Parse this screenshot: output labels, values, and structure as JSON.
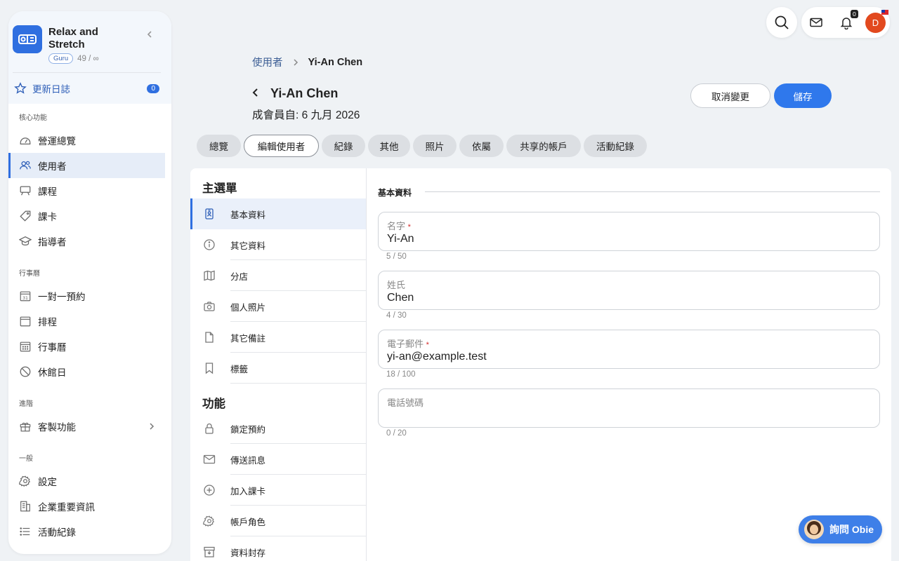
{
  "sidebar": {
    "org_name": "Relax and Stretch",
    "plan_badge": "Guru",
    "usage": "49 / ∞",
    "changelog": {
      "label": "更新日誌",
      "count": "0"
    },
    "sections": [
      {
        "label": "核心功能",
        "items": [
          {
            "label": "營運總覽",
            "icon": "dashboard-icon"
          },
          {
            "label": "使用者",
            "icon": "users-icon",
            "active": true
          },
          {
            "label": "課程",
            "icon": "classroom-icon"
          },
          {
            "label": "課卡",
            "icon": "tag-icon"
          },
          {
            "label": "指導者",
            "icon": "graduation-cap-icon"
          }
        ]
      },
      {
        "label": "行事曆",
        "items": [
          {
            "label": "一對一預約",
            "icon": "calendar-31-icon"
          },
          {
            "label": "排程",
            "icon": "calendar-icon"
          },
          {
            "label": "行事曆",
            "icon": "calendar-grid-icon"
          },
          {
            "label": "休館日",
            "icon": "ban-icon"
          }
        ]
      },
      {
        "label": "進階",
        "items": [
          {
            "label": "客製功能",
            "icon": "gift-icon"
          }
        ]
      },
      {
        "label": "一般",
        "items": [
          {
            "label": "設定",
            "icon": "gear-icon"
          },
          {
            "label": "企業重要資訊",
            "icon": "building-icon"
          },
          {
            "label": "活動紀錄",
            "icon": "list-icon"
          }
        ]
      }
    ]
  },
  "topbar": {
    "bell_count": "0",
    "avatar_initial": "D"
  },
  "breadcrumb": {
    "parent": "使用者",
    "current": "Yi-An Chen"
  },
  "header": {
    "title": "Yi-An Chen",
    "member_since": "成會員自: 6 九月 2026",
    "cancel_label": "取消變更",
    "save_label": "儲存"
  },
  "tabs": [
    "總覽",
    "編輯使用者",
    "紀錄",
    "其他",
    "照片",
    "依屬",
    "共享的帳戶",
    "活動紀錄"
  ],
  "active_tab": "編輯使用者",
  "menu": {
    "main_heading": "主選單",
    "main_items": [
      {
        "label": "基本資料",
        "icon": "id-badge-icon",
        "active": true
      },
      {
        "label": "其它資料",
        "icon": "info-circle-icon"
      },
      {
        "label": "分店",
        "icon": "map-icon"
      },
      {
        "label": "個人照片",
        "icon": "camera-icon"
      },
      {
        "label": "其它備註",
        "icon": "document-icon"
      },
      {
        "label": "標籤",
        "icon": "bookmark-icon"
      }
    ],
    "feature_heading": "功能",
    "feature_items": [
      {
        "label": "鎖定預約",
        "icon": "lock-icon"
      },
      {
        "label": "傳送訊息",
        "icon": "mail-icon"
      },
      {
        "label": "加入課卡",
        "icon": "plus-circle-icon"
      },
      {
        "label": "帳戶角色",
        "icon": "gear-icon"
      },
      {
        "label": "資料封存",
        "icon": "archive-icon"
      }
    ]
  },
  "form": {
    "section_title": "基本資料",
    "fields": [
      {
        "label": "名字",
        "required": true,
        "value": "Yi-An",
        "counter": "5 / 50"
      },
      {
        "label": "姓氏",
        "required": false,
        "value": "Chen",
        "counter": "4 / 30"
      },
      {
        "label": "電子郵件",
        "required": true,
        "value": "yi-an@example.test",
        "counter": "18 / 100"
      },
      {
        "label": "電話號碼",
        "required": false,
        "value": "",
        "counter": "0 / 20"
      }
    ]
  },
  "assistant": {
    "label": "詢問 Obie"
  },
  "colors": {
    "accent": "#2f6fe0",
    "save": "#2f78ec",
    "avatar": "#e2491e",
    "required": "#d42a2a"
  }
}
